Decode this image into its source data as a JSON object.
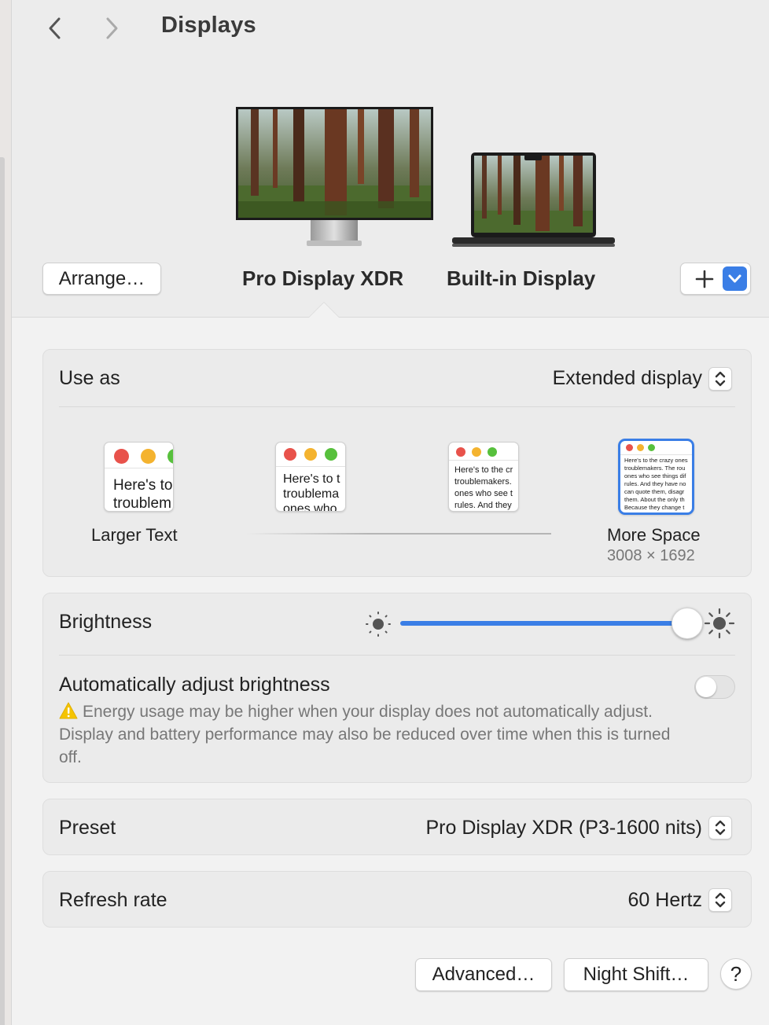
{
  "window": {
    "title": "Displays"
  },
  "nav": {
    "back_icon": "chevron-left-icon",
    "forward_icon": "chevron-right-icon"
  },
  "header": {
    "arrange_label": "Arrange…",
    "displays": [
      {
        "name": "Pro Display XDR",
        "selected": true,
        "image": "monitor-redwood-forest-wallpaper"
      },
      {
        "name": "Built-in Display",
        "selected": false,
        "image": "laptop-redwood-forest-wallpaper"
      }
    ],
    "add_icon": "plus-icon",
    "menu_icon": "chevron-down-icon"
  },
  "use_as": {
    "label": "Use as",
    "value": "Extended display"
  },
  "resolution": {
    "options": [
      {
        "label": "Larger Text",
        "sample": "Here's to\ntroublem"
      },
      {
        "label": "",
        "sample": "Here's to t\ntroublema\nones who"
      },
      {
        "label": "",
        "sample": "Here's to the cr\ntroublemakers.\nones who see t\nrules. And they"
      },
      {
        "label": "More Space",
        "sublabel": "3008 × 1692",
        "selected": true,
        "sample": "Here's to the crazy ones\ntroublemakers. The rou\nones who see things dif\nrules. And they have no\ncan quote them, disagr\nthem. About the only th\nBecause they change t"
      }
    ]
  },
  "brightness": {
    "label": "Brightness",
    "level": 1.0,
    "low_icon": "sun-dim-icon",
    "high_icon": "sun-bright-icon"
  },
  "auto_brightness": {
    "label": "Automatically adjust brightness",
    "enabled": false,
    "warning_icon": "warning-icon",
    "description": "Energy usage may be higher when your display does not automatically adjust. Display and battery performance may also be reduced over time when this is turned off."
  },
  "preset": {
    "label": "Preset",
    "value": "Pro Display XDR (P3-1600 nits)"
  },
  "refresh_rate": {
    "label": "Refresh rate",
    "value": "60 Hertz"
  },
  "footer": {
    "advanced_label": "Advanced…",
    "night_shift_label": "Night Shift…",
    "help_label": "?"
  },
  "colors": {
    "accent": "#3a7ee6",
    "slider_track": "#d6d6d6",
    "warning": "#f5c400"
  }
}
